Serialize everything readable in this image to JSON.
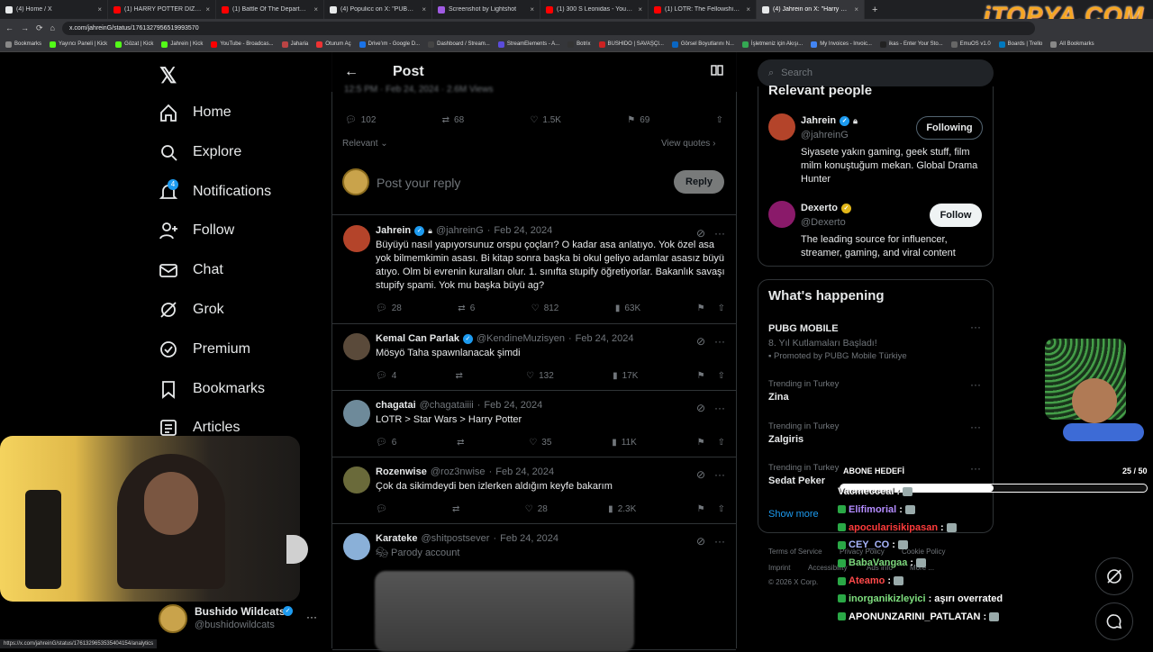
{
  "browser": {
    "tabs": [
      {
        "title": "(4) Home / X",
        "color": "#e7e9ea"
      },
      {
        "title": "(1) HARRY POTTER DİZİSİ FRAGMAN",
        "color": "#ff0000"
      },
      {
        "title": "(1) Battle Of The Department of M",
        "color": "#ff0000"
      },
      {
        "title": "(4) Populicc on X: \"PUBG Mobile",
        "color": "#e7e9ea"
      },
      {
        "title": "Screenshot by Lightshot",
        "color": "#a05be3"
      },
      {
        "title": "(1) 300 S Leonidas - YouTube",
        "color": "#ff0000"
      },
      {
        "title": "(1) LOTR: The Fellowship of the Ri",
        "color": "#ff0000"
      },
      {
        "title": "(4) Jahrein on X: \"Harry Potter d",
        "color": "#e7e9ea",
        "active": true
      }
    ],
    "url": "x.com/jahreinG/status/1761327956519993570",
    "bookmarks": [
      "Bookmarks",
      "Yayıncı Paneli | Kick",
      "Gözat | Kick",
      "Jahrein | Kick",
      "YouTube - Broadcas...",
      "Jaharia",
      "Oturum Aç",
      "Drive'ım - Google D...",
      "Dashboard / Stream...",
      "StreamElements - A...",
      "Botrix",
      "BUSHIDO | SAVAŞÇI...",
      "Görsel Boyutlarını N...",
      "İşletmeniz için Akışı...",
      "My Invoices - Invoic...",
      "ikas - Enter Your Sto...",
      "EmuOS v1.0",
      "Boards | Trello",
      "All Bookmarks"
    ],
    "status_url": "https://x.com/jahreinG/status/1761329653535404154/analytics"
  },
  "logo": "iTOPYA.COM",
  "nav": {
    "items": [
      "Home",
      "Explore",
      "Notifications",
      "Follow",
      "Chat",
      "Grok",
      "Premium",
      "Bookmarks",
      "Articles"
    ],
    "notif_count": "4",
    "account_name": "Bushido Wildcats",
    "account_handle": "@bushidowildcats"
  },
  "post": {
    "header": "Post",
    "stats": {
      "replies": "102",
      "reposts": "68",
      "likes": "1.5K",
      "bookmarks": "69"
    },
    "sort": "Relevant",
    "view_quotes": "View quotes",
    "reply_placeholder": "Post your reply",
    "reply_button": "Reply"
  },
  "tweets": [
    {
      "name": "Jahrein",
      "handle": "@jahreinG",
      "date": "Feb 24, 2024",
      "text": "Büyüyü nasıl yapıyorsunuz orspu çoçları? O kadar asa anlatıyo. Yok özel asa yok bilmemkimin asası. Bi kitap sonra başka bi okul geliyo adamlar asasız büyü atıyo. Olm bi evrenin kuralları olur. 1. sınıfta stupify öğretiyorlar. Bakanlık savaşı stupify spami. Yok mu başka büyü ag?",
      "replies": "28",
      "reposts": "6",
      "likes": "812",
      "views": "63K"
    },
    {
      "name": "Kemal Can Parlak",
      "handle": "@KendineMuzisyen",
      "date": "Feb 24, 2024",
      "text": "Mösyö Taha spawnlanacak şimdi",
      "replies": "4",
      "reposts": "",
      "likes": "132",
      "views": "17K"
    },
    {
      "name": "chagatai",
      "handle": "@chagataiiii",
      "date": "Feb 24, 2024",
      "text": "LOTR > Star Wars > Harry Potter",
      "replies": "6",
      "reposts": "",
      "likes": "35",
      "views": "11K"
    },
    {
      "name": "Rozenwise",
      "handle": "@roz3nwise",
      "date": "Feb 24, 2024",
      "text": "Çok da sikimdeydi ben izlerken aldığım keyfe bakarım",
      "replies": "",
      "reposts": "",
      "likes": "28",
      "views": "2.3K"
    },
    {
      "name": "Karateke",
      "handle": "@shitpostsever",
      "date": "Feb 24, 2024",
      "text": "Parody account",
      "replies": "",
      "reposts": "",
      "likes": "",
      "views": ""
    }
  ],
  "right": {
    "search_placeholder": "Search",
    "relevant_title": "Relevant people",
    "people": [
      {
        "name": "Jahrein",
        "handle": "@jahreinG",
        "bio": "Siyasete yakın gaming, geek stuff, film milm konuştuğum mekan. Global Drama Hunter",
        "button": "Following"
      },
      {
        "name": "Dexerto",
        "handle": "@Dexerto",
        "bio": "The leading source for influencer, streamer, gaming, and viral content",
        "button": "Follow"
      }
    ],
    "happening_title": "What's happening",
    "trends": [
      {
        "context": "",
        "name": "PUBG MOBILE",
        "extra": "8. Yıl Kutlamaları Başladı!",
        "promo": "Promoted by PUBG Mobile Türkiye"
      },
      {
        "context": "Trending in Turkey",
        "name": "Zina"
      },
      {
        "context": "Trending in Turkey",
        "name": "Zalgiris"
      },
      {
        "context": "Trending in Turkey",
        "name": "Sedat Peker"
      }
    ],
    "show_more": "Show more",
    "footer": [
      "Terms of Service",
      "Privacy Policy",
      "Cookie Policy",
      "Imprint",
      "Accessibility",
      "Ads info",
      "More ...",
      "© 2026 X Corp."
    ]
  },
  "stream": {
    "goal_label": "ABONE HEDEFİ",
    "goal_count": "25 / 50",
    "goal_fraction": 0.5,
    "chat": [
      {
        "user": "Vacmecceal",
        "text": "",
        "color": "#ffffff"
      },
      {
        "user": "Elifimorial",
        "text": "",
        "color": "#b48cff"
      },
      {
        "user": "apocularisikipasan",
        "text": "",
        "color": "#ff3b3b"
      },
      {
        "user": "CEY_CO",
        "text": "",
        "color": "#a9b7ff"
      },
      {
        "user": "BabaVangaa",
        "text": "",
        "color": "#7dd87d"
      },
      {
        "user": "Ateamo",
        "text": "",
        "color": "#ff4a4a"
      },
      {
        "user": "inorganikizleyici",
        "text": "aşırı overrated",
        "color": "#7fe07f"
      },
      {
        "user": "APONUNZARINI_PATLATAN",
        "text": "",
        "color": "#ffffff"
      }
    ]
  }
}
